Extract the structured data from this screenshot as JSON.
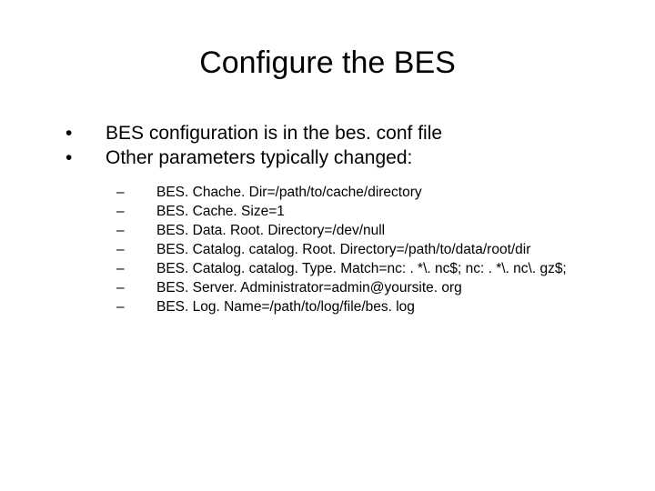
{
  "title": "Configure the BES",
  "level1": [
    {
      "text": "BES configuration is in the bes. conf file"
    },
    {
      "text": "Other parameters typically changed:"
    }
  ],
  "level2": [
    {
      "text": "BES. Chache. Dir=/path/to/cache/directory"
    },
    {
      "text": "BES. Cache. Size=1"
    },
    {
      "text": "BES. Data. Root. Directory=/dev/null"
    },
    {
      "text": "BES. Catalog. catalog. Root. Directory=/path/to/data/root/dir"
    },
    {
      "text": "BES. Catalog. catalog. Type. Match=nc: . *\\. nc$; nc: . *\\. nc\\. gz$;"
    },
    {
      "text": "BES. Server. Administrator=admin@yoursite. org"
    },
    {
      "text": "BES. Log. Name=/path/to/log/file/bes. log"
    }
  ],
  "bullets": {
    "level1": "•",
    "level2": "–"
  }
}
